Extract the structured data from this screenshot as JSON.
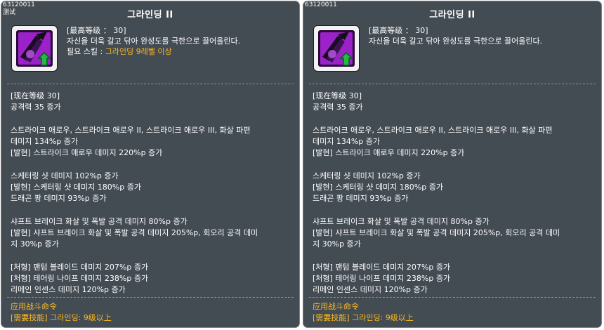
{
  "panels": [
    {
      "id_label": "63120011",
      "sub_label": "测试",
      "title": "그라인딩 II",
      "icon": "dark-blade-skill-icon",
      "header": {
        "max_level": "[最高等级 ： 30]",
        "description": "자신을 더욱 갈고 닦아 완성도를 극한으로 끌어올린다.",
        "req_prefix": "필요 스킬 : ",
        "req_value": "그라인딩 9레벨 이상"
      },
      "current_level": "[现在等级 30]",
      "lines": [
        "공격력 35 증가",
        "",
        "스트라이크 애로우, 스트라이크 애로우 II, 스트라이크 애로우 III, 화살 파편",
        "데미지 134%p 증가",
        "[발현] 스트라이크 애로우 데미지 220%p 증가",
        "",
        "스케터링 샷 데미지 102%p 증가",
        "[발현] 스케터링 샷 데미지 180%p 증가",
        "드래곤 팡 데미지 93%p 증가",
        "",
        "샤프트 브레이크 화살 및 폭발 공격 데미지 80%p 증가",
        "[발현] 샤프트 브레이크 화살 및 폭발 공격 데미지 205%p, 회오리 공격 데미",
        "지 30%p 증가",
        "",
        "[처형] 팬텀 블레이드 데미지 207%p 증가",
        "[처형] 테어링 나이프 데미지 238%p 증가",
        "리메인 인센스 데미지 120%p 증가"
      ],
      "footer_title": "应用战斗命令",
      "footer_req": "[需要技能] 그라인딩: 9级以上"
    },
    {
      "id_label": "63120011",
      "title": "그라인딩 II",
      "icon": "dark-blade-skill-icon",
      "header": {
        "max_level": "[最高等级 ： 30]",
        "description": "자신을 더욱 갈고 닦아 완성도를 극한으로 끌어올린다."
      },
      "current_level": "[现在等级 30]",
      "lines": [
        "공격력 35 증가",
        "",
        "스트라이크 애로우, 스트라이크 애로우 II, 스트라이크 애로우 III, 화살 파편",
        "데미지 134%p 증가",
        "[발현] 스트라이크 애로우 데미지 220%p 증가",
        "",
        "스케터링 샷 데미지 102%p 증가",
        "[발현] 스케터링 샷 데미지 180%p 증가",
        "드래곤 팡 데미지 93%p 증가",
        "",
        "샤프트 브레이크 화살 및 폭발 공격 데미지 80%p 증가",
        "[발현] 샤프트 브레이크 화살 및 폭발 공격 데미지 205%p, 회오리 공격 데미",
        "지 30%p 증가",
        "",
        "[처형] 팬텀 블레이드 데미지 207%p 증가",
        "[처형] 테어링 나이프 데미지 238%p 증가",
        "리메인 인센스 데미지 120%p 증가"
      ],
      "footer_title": "应用战斗命令",
      "footer_req": "[需要技能] 그라인딩: 9级以上"
    }
  ],
  "colors": {
    "panel_bg": "#434b53",
    "text": "#ffffff",
    "accent_orange": "#ffbb22",
    "icon_purple": "#b030d8",
    "icon_arrow_green": "#22bb44"
  }
}
